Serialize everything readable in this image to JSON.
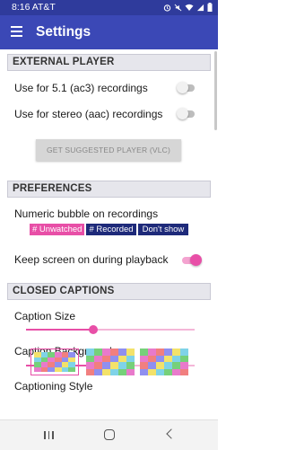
{
  "status_bar": {
    "time": "8:16",
    "carrier": "AT&T",
    "icons": [
      "alarm-icon",
      "mute-icon",
      "wifi-icon",
      "signal-icon",
      "battery-icon"
    ]
  },
  "app_bar": {
    "title": "Settings",
    "menu_icon": "hamburger-menu-icon"
  },
  "external_player": {
    "header": "EXTERNAL PLAYER",
    "ac3_label": "Use for 5.1 (ac3) recordings",
    "ac3_enabled": false,
    "aac_label": "Use for stereo (aac) recordings",
    "aac_enabled": false,
    "suggest_button": "GET SUGGESTED PLAYER (VLC)"
  },
  "preferences": {
    "header": "PREFERENCES",
    "bubble_label": "Numeric bubble on recordings",
    "bubble_options": [
      "# Unwatched",
      "# Recorded",
      "Don't show"
    ],
    "bubble_selected": "# Unwatched",
    "keep_screen_label": "Keep screen on during playback",
    "keep_screen_enabled": true
  },
  "closed_captions": {
    "header": "CLOSED CAPTIONS",
    "caption_size_label": "Caption Size",
    "caption_size_level": 0.4,
    "caption_background_label": "Caption Background",
    "caption_background_level": 0.4,
    "captioning_style_label": "Captioning Style",
    "style_tiles": [
      "style-1",
      "style-2",
      "style-3"
    ],
    "selected_style": "style-1"
  },
  "colors": {
    "status_bar": "#2f3b9c",
    "app_bar": "#3b48b6",
    "accent_pink": "#e84fa7",
    "navy": "#1e2a7a"
  },
  "nav_bar": {
    "icons": [
      "recent-apps-icon",
      "home-icon",
      "back-icon"
    ]
  }
}
